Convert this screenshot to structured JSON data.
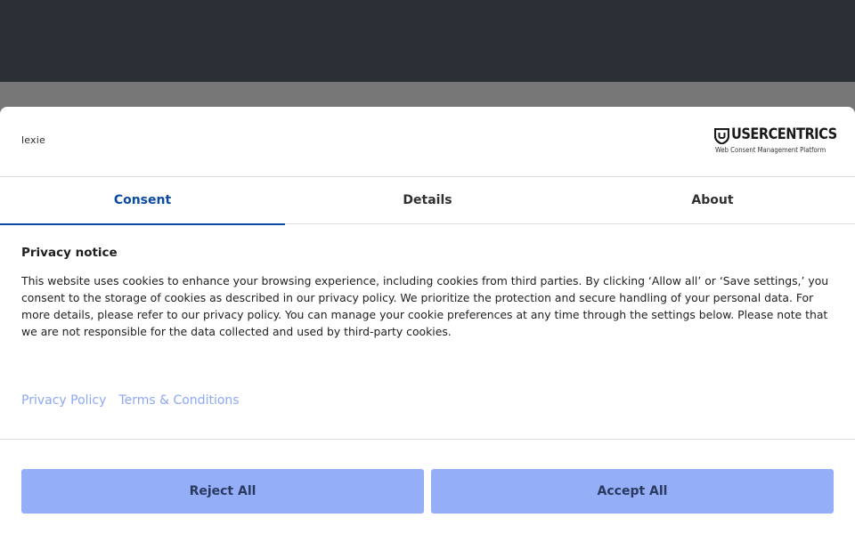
{
  "brand": {
    "logo_text": "lexie"
  },
  "provider": {
    "name": "USERCENTRICS",
    "tagline": "Web Consent Management Platform"
  },
  "tabs": [
    {
      "label": "Consent",
      "active": true
    },
    {
      "label": "Details",
      "active": false
    },
    {
      "label": "About",
      "active": false
    }
  ],
  "notice": {
    "title": "Privacy notice",
    "body": "This website uses cookies to enhance your browsing experience, including cookies from third parties. By clicking ‘Allow all’ or ‘Save settings,’ you consent to the storage of cookies as described in our privacy policy. We prioritize the protection and secure handling of your personal data. For more details, please refer to our privacy policy. You can manage your cookie preferences at any time through the settings below. Please note that we are not responsible for the data collected and used by third-party cookies."
  },
  "links": {
    "privacy_policy": "Privacy Policy",
    "terms": "Terms & Conditions"
  },
  "buttons": {
    "reject": "Reject All",
    "accept": "Accept All"
  },
  "colors": {
    "accent": "#0b4aa0",
    "button_bg": "#94aef8",
    "link": "#8ea8f5",
    "backdrop": "#2b2f36"
  }
}
